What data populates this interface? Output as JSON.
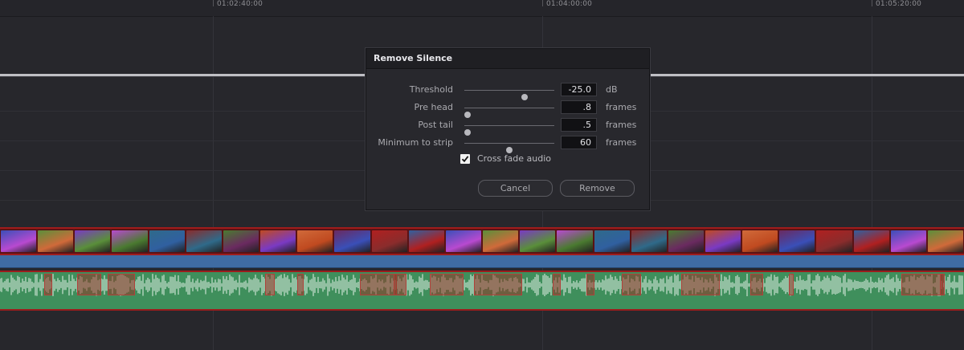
{
  "ruler": {
    "timecodes": [
      "01:02:40:00",
      "01:04:00:00",
      "01:05:20:00"
    ]
  },
  "dialog": {
    "title": "Remove Silence",
    "threshold": {
      "label": "Threshold",
      "value": "-25.0",
      "unit": "dB",
      "slider_fraction": 0.68
    },
    "pre_head": {
      "label": "Pre head",
      "value": ".8",
      "unit": "frames",
      "slider_fraction": 0.0
    },
    "post_tail": {
      "label": "Post tail",
      "value": ".5",
      "unit": "frames",
      "slider_fraction": 0.0
    },
    "minimum_to_strip": {
      "label": "Minimum to strip",
      "value": "60",
      "unit": "frames",
      "slider_fraction": 0.5
    },
    "cross_fade": {
      "label": "Cross fade audio",
      "checked": true
    },
    "cancel_label": "Cancel",
    "remove_label": "Remove"
  },
  "colors": {
    "video_track": "#5a1214",
    "audio_track_blue": "#3f6ca3",
    "audio_track_green": "#3f8f5c",
    "silence_region": "#963728"
  }
}
